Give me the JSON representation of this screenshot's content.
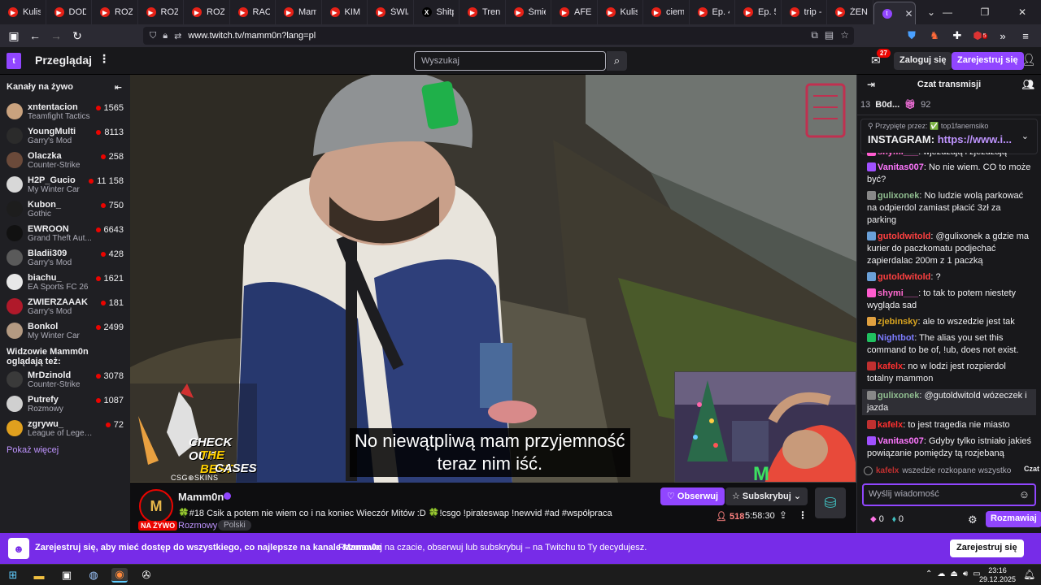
{
  "browser": {
    "tabs": [
      {
        "icon": "youtube",
        "title": "Kulisy p"
      },
      {
        "icon": "youtube",
        "title": "DODA:"
      },
      {
        "icon": "youtube",
        "title": "ROZMO"
      },
      {
        "icon": "youtube",
        "title": "ROZMO"
      },
      {
        "icon": "youtube",
        "title": "ROZMO"
      },
      {
        "icon": "youtube",
        "title": "RACHU"
      },
      {
        "icon": "youtube",
        "title": "Mamm"
      },
      {
        "icon": "youtube",
        "title": "KIM NA"
      },
      {
        "icon": "youtube",
        "title": "ŚWIĄTE"
      },
      {
        "icon": "x",
        "title": "Shitpos"
      },
      {
        "icon": "youtube",
        "title": "Trening"
      },
      {
        "icon": "youtube",
        "title": "Śmierte"
      },
      {
        "icon": "youtube",
        "title": "AFERA"
      },
      {
        "icon": "youtube",
        "title": "Kulisy p"
      },
      {
        "icon": "youtube",
        "title": "ciemna"
      },
      {
        "icon": "youtube",
        "title": "Ep. 4 \"S"
      },
      {
        "icon": "youtube",
        "title": "Ep. 5 \"S"
      },
      {
        "icon": "youtube",
        "title": "trip - Yo"
      },
      {
        "icon": "youtube",
        "title": "ŻENUJĄ"
      },
      {
        "icon": "twitch",
        "title": "Mam",
        "active": true
      }
    ],
    "url": "www.twitch.tv/mamm0n?lang=pl",
    "extension_badge": "5"
  },
  "twitch_nav": {
    "browse_label": "Przeglądaj",
    "search_placeholder": "Wyszukaj",
    "inbox_count": "27",
    "login_label": "Zaloguj się",
    "signup_label": "Zarejestruj się"
  },
  "sidebar": {
    "live_header": "Kanały na żywo",
    "live_channels": [
      {
        "name": "xntentacion",
        "game": "Teamfight Tactics",
        "viewers": "1565",
        "color": "#c9a27e"
      },
      {
        "name": "YoungMulti",
        "game": "Garry's Mod",
        "viewers": "8113",
        "color": "#2b2b2b"
      },
      {
        "name": "Olaczka",
        "game": "Counter-Strike",
        "viewers": "258",
        "color": "#6b4a3a"
      },
      {
        "name": "H2P_Gucio",
        "game": "My Winter Car",
        "viewers": "11 158",
        "color": "#d8d8d8"
      },
      {
        "name": "Kubon_",
        "game": "Gothic",
        "viewers": "750",
        "color": "#1d1d1d"
      },
      {
        "name": "EWROON",
        "game": "Grand Theft Aut...",
        "viewers": "6643",
        "color": "#111111"
      },
      {
        "name": "Bladii309",
        "game": "Garry's Mod",
        "viewers": "428",
        "color": "#5a5a5a"
      },
      {
        "name": "biachu_",
        "game": "EA Sports FC 26",
        "viewers": "1621",
        "color": "#e8e8e8"
      },
      {
        "name": "ZWIERZAAAK",
        "game": "Garry's Mod",
        "viewers": "181",
        "color": "#b0192a"
      },
      {
        "name": "Bonkol",
        "game": "My Winter Car",
        "viewers": "2499",
        "color": "#b49a82"
      }
    ],
    "watched_header": "Widzowie Mamm0n oglądają też:",
    "watched_channels": [
      {
        "name": "MrDzinold",
        "game": "Counter-Strike",
        "viewers": "3078",
        "color": "#3a3a3a"
      },
      {
        "name": "Putrefy",
        "game": "Rozmowy",
        "viewers": "1087",
        "color": "#d0d0d0"
      },
      {
        "name": "zgrywu_",
        "game": "League of Legends",
        "viewers": "72",
        "color": "#e0a01e"
      }
    ],
    "show_more": "Pokaż więcej"
  },
  "video": {
    "subtitle_line1": "No niewątpliwą mam przyjemność",
    "subtitle_line2": "teraz nim iść.",
    "promo_line1": "CHECK OUT",
    "promo_line2": "THE BEST",
    "promo_line3": "CASES",
    "promo_brand": "CSG⊕SKINS"
  },
  "channel": {
    "name": "Mamm0n",
    "avatar_letter": "M",
    "live_label": "NA ŻYWO",
    "title": "🍀#18 Csik a potem nie wiem co i na koniec Wieczór Mitów :D 🍀!csgo !pirateswap !newvid #ad #współpraca",
    "category": "Rozmowy",
    "tag": "Polski",
    "follow_label": "Obserwuj",
    "subscribe_label": "Subskrybuj",
    "viewers": "518",
    "uptime": "5:58:30"
  },
  "chat": {
    "header": "Czat transmisji",
    "gift_prefix": "13",
    "gift_user": "B0d...",
    "gift_count": "92",
    "pinned_by": "Przypięte przez: ✅ top1fanemsiko",
    "pinned_prefix": "INSTAGRAM: ",
    "pinned_link": "https://www.i...",
    "messages": [
      {
        "user": "shymi___",
        "color": "#ff69d0",
        "badge": "#ff5ccf",
        "text": "wjeżdżają i zjeżdżają",
        "cut": true
      },
      {
        "user": "Vanitas007",
        "color": "#ff77ff",
        "badge": "#a050ff",
        "text": "No nie wiem. CO to może być?"
      },
      {
        "user": "gulixonek",
        "color": "#8fbc8f",
        "badge": "#888888",
        "text": "No ludzie wolą parkować na odpierdol zamiast płacić 3zł za parking"
      },
      {
        "user": "gutoldwitold",
        "color": "#ff4040",
        "badge": "#6aa0d8",
        "text": "@gulixonek a gdzie ma kurier do paczkomatu podjechać zapierdalac 200m z 1 paczką"
      },
      {
        "user": "gutoldwitold",
        "color": "#ff4040",
        "badge": "#6aa0d8",
        "text": "?"
      },
      {
        "user": "shymi___",
        "color": "#ff69d0",
        "badge": "#ff5ccf",
        "text": "to tak to potem niestety wygląda sad"
      },
      {
        "user": "zjebinsky",
        "color": "#daa520",
        "badge": "#e0a040",
        "text": "ale to wszedzie jest tak"
      },
      {
        "user": "Nightbot",
        "color": "#7c7cff",
        "badge": "#20c060",
        "text": "The alias you set this command to be of, !ub, does not exist."
      },
      {
        "user": "kafelx",
        "color": "#ff3030",
        "badge": "#c03030",
        "text": "no w lodzi jest rozpierdol totalny mammon"
      },
      {
        "user": "gulixonek",
        "color": "#8fbc8f",
        "badge": "#888888",
        "text": "@gutoldwitold wózeczek i jazda",
        "hl": true
      },
      {
        "user": "kafelx",
        "color": "#ff3030",
        "badge": "#c03030",
        "text": "to jest tragedia nie miasto"
      },
      {
        "user": "Vanitas007",
        "color": "#ff77ff",
        "badge": "#a050ff",
        "text": "Gdyby tylko istniało jakieś powiązanie pomiędzy tą rozjebaną ziemią, chodnikiem i samochodami Hmm"
      }
    ],
    "footer_user": "kafelx",
    "footer_text": "wszedzie rozkopane wszystko",
    "footer_label": "Czat",
    "input_placeholder": "Wyślij wiadomość",
    "points_a": "0",
    "points_b": "0",
    "send_label": "Rozmawiaj"
  },
  "banner": {
    "bold_text": "Zarejestruj się, aby mieć dostęp do wszystkiego, co najlepsze na kanale Mamm0n",
    "reg_text": "Rozmawiaj na czacie, obserwuj lub subskrybuj – na Twitchu to Ty decydujesz.",
    "button_label": "Zarejestruj się"
  },
  "taskbar": {
    "time": "23:16",
    "date": "29.12.2025"
  }
}
